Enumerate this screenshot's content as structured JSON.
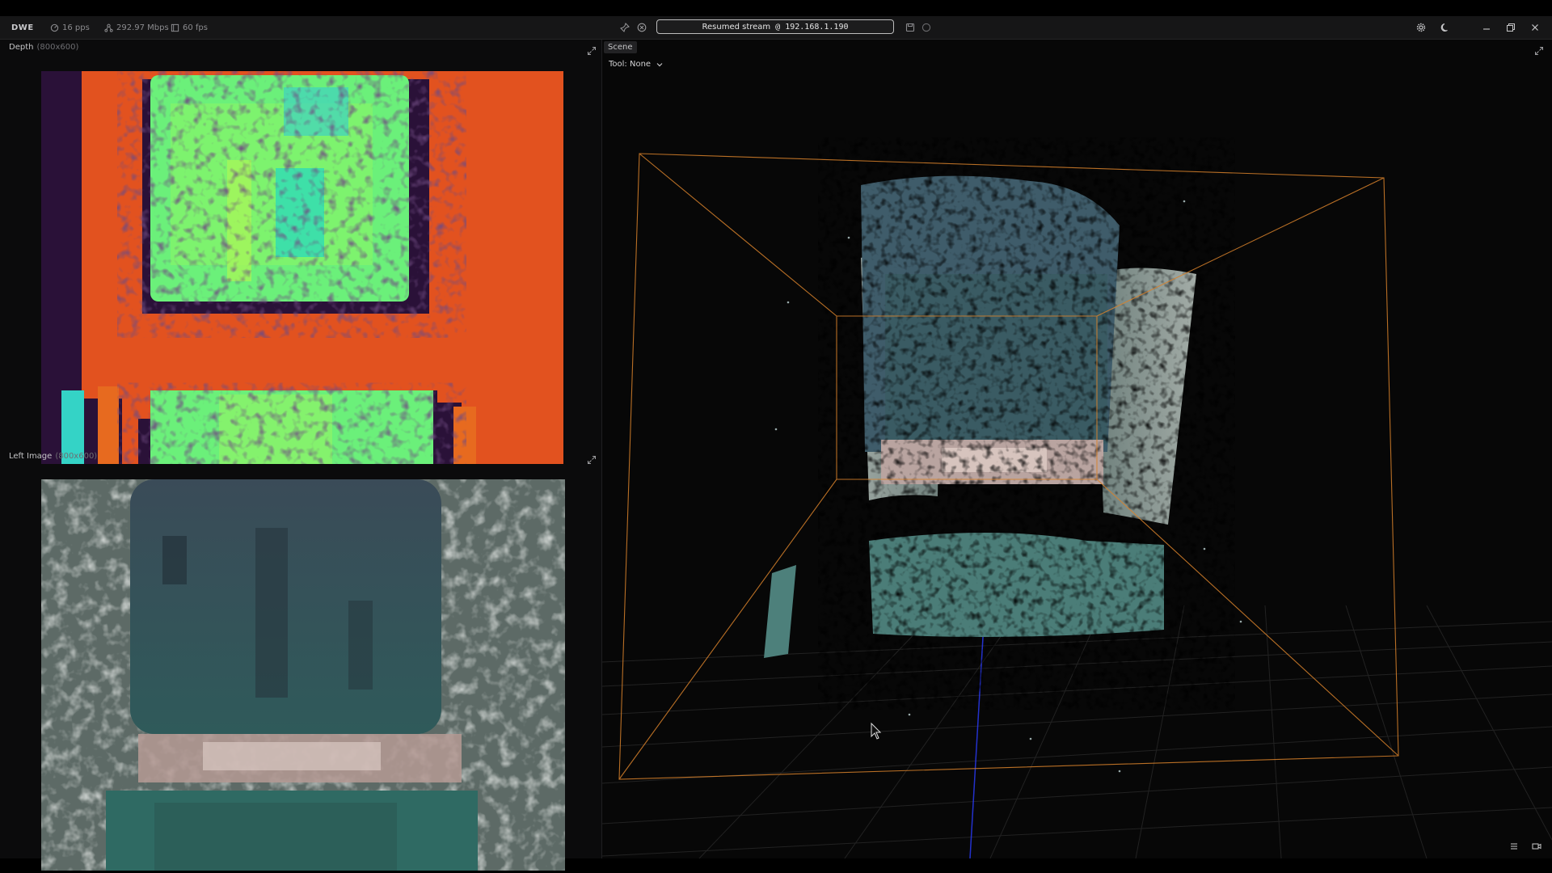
{
  "app": {
    "logo": "DWE",
    "stats": {
      "pps": "16 pps",
      "bandwidth": "292.97 Mbps",
      "fps": "60 fps"
    },
    "stream": {
      "status": "Resumed stream",
      "address": "@ 192.168.1.190"
    }
  },
  "panels": {
    "depth": {
      "title": "Depth",
      "resolution": "(800x600)"
    },
    "left_image": {
      "title": "Left Image",
      "resolution": "(800x600)"
    },
    "scene": {
      "tab": "Scene",
      "tool_label": "Tool: None"
    }
  },
  "icons": {
    "pps": "gauge-icon",
    "bandwidth": "network-icon",
    "fps": "frame-icon",
    "pin": "pin-icon",
    "stop": "stop-circle-icon",
    "record": "save-icon",
    "status": "circle-icon",
    "settings": "gear-icon",
    "theme": "moon-icon",
    "minimize": "minimize-icon",
    "maximize": "restore-icon",
    "close": "close-icon",
    "layers": "layers-icon",
    "camera": "camera-icon"
  },
  "colors": {
    "accent_box": "#d9822b",
    "axis_blue": "#2b3cff",
    "depth_near": "#e2521f",
    "depth_far": "#2a1138",
    "depth_mid": "#6bf07a"
  }
}
